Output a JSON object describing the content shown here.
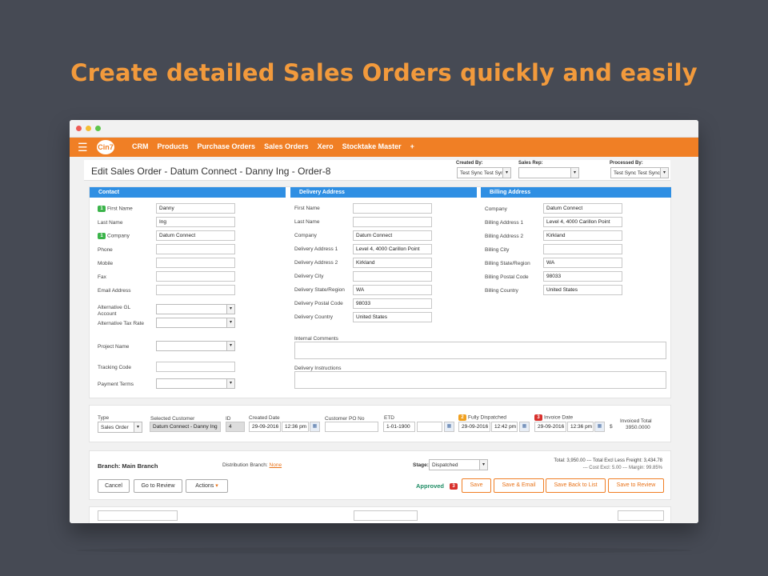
{
  "headline": "Create detailed Sales Orders quickly and easily",
  "nav": {
    "logo": "Cin7",
    "items": [
      "CRM",
      "Products",
      "Purchase Orders",
      "Sales Orders",
      "Xero",
      "Stocktake Master",
      "+"
    ]
  },
  "page": {
    "title": "Edit Sales Order - Datum Connect - Danny Ing - Order-8",
    "created_by_label": "Created By:",
    "created_by_value": "Test Sync Test Sync",
    "sales_rep_label": "Sales Rep:",
    "sales_rep_value": "",
    "processed_by_label": "Processed By:",
    "processed_by_value": "Test Sync Test Sync"
  },
  "contact": {
    "heading": "Contact",
    "first_name_label": "First Name",
    "first_name": "Danny",
    "last_name_label": "Last Name",
    "last_name": "Ing",
    "company_label": "Company",
    "company": "Datum Connect",
    "phone_label": "Phone",
    "mobile_label": "Mobile",
    "fax_label": "Fax",
    "email_label": "Email Address",
    "alt_gl_label": "Alternative GL Account",
    "alt_tax_label": "Alternative Tax Rate",
    "project_label": "Project Name",
    "tracking_label": "Tracking Code",
    "payment_label": "Payment Terms",
    "badge": "1"
  },
  "delivery": {
    "heading": "Delivery Address",
    "first_name_label": "First Name",
    "last_name_label": "Last Name",
    "company_label": "Company",
    "company": "Datum Connect",
    "addr1_label": "Delivery Address 1",
    "addr1": "Level 4, 4000 Carillon Point",
    "addr2_label": "Delivery Address 2",
    "addr2": "Kirkland",
    "city_label": "Delivery City",
    "state_label": "Delivery State/Region",
    "state": "WA",
    "postal_label": "Delivery Postal Code",
    "postal": "98033",
    "country_label": "Delivery Country",
    "country": "United States",
    "internal_comments_label": "Internal Comments",
    "instructions_label": "Delivery Instructions"
  },
  "billing": {
    "heading": "Billing Address",
    "company_label": "Company",
    "company": "Datum Connect",
    "addr1_label": "Billing Address 1",
    "addr1": "Level 4, 4000 Carillon Point",
    "addr2_label": "Billing Address 2",
    "addr2": "Kirkland",
    "city_label": "Billing City",
    "state_label": "Billing State/Region",
    "state": "WA",
    "postal_label": "Billing Postal Code",
    "postal": "98033",
    "country_label": "Billing Country",
    "country": "United States"
  },
  "order": {
    "type_label": "Type",
    "type_value": "Sales Order",
    "customer_label": "Selected Customer",
    "customer_value": "Datum Connect - Danny Ing",
    "id_label": "ID",
    "id_value": "4",
    "created_label": "Created Date",
    "created_date": "29-09-2016",
    "created_time": "12:36 pm",
    "po_label": "Customer PO No",
    "etd_label": "ETD",
    "etd_value": "1-01-1900",
    "dispatched_label": "Fully Dispatched",
    "dispatched_date": "29-09-2016",
    "dispatched_time": "12:42 pm",
    "dispatched_badge": "2",
    "invoice_label": "Invoice Date",
    "invoice_date": "29-09-2016",
    "invoice_time": "12:36 pm",
    "invoice_badge": "3",
    "currency": "$",
    "invoiced_total_label": "Invoiced Total",
    "invoiced_total": "3950.0000"
  },
  "footer": {
    "branch": "Branch: Main Branch",
    "dist_label": "Distribution Branch:",
    "dist_value": "None",
    "stage_label": "Stage:",
    "stage_value": "Dispatched",
    "total_line": "Total: 3,950.00 --- Total Excl Less Freight: 3,434.78",
    "cost_line": "--- Cost Excl: 5.00 --- Margin: 99.85%",
    "cancel": "Cancel",
    "review": "Go to Review",
    "actions": "Actions",
    "approved": "Approved",
    "approved_badge": "3",
    "save": "Save",
    "save_email": "Save & Email",
    "save_back": "Save Back to List",
    "save_review": "Save to Review"
  }
}
